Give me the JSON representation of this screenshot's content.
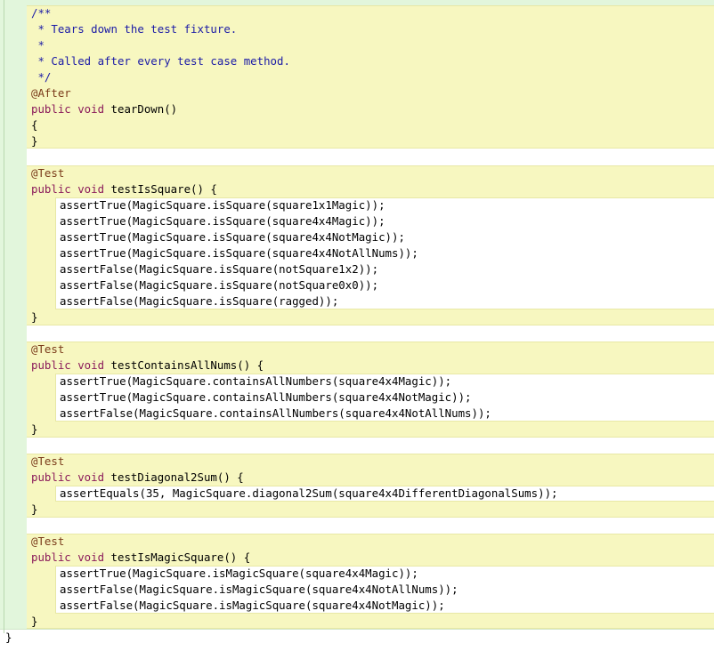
{
  "editor": {
    "lines": [
      {
        "indent": 1,
        "tokens": [
          {
            "t": "/**",
            "k": "comment"
          }
        ]
      },
      {
        "indent": 1,
        "tokens": [
          {
            "t": " * Tears down the test fixture.",
            "k": "comment"
          }
        ]
      },
      {
        "indent": 1,
        "tokens": [
          {
            "t": " *",
            "k": "comment"
          }
        ]
      },
      {
        "indent": 1,
        "tokens": [
          {
            "t": " * Called after every test case method.",
            "k": "comment"
          }
        ]
      },
      {
        "indent": 1,
        "tokens": [
          {
            "t": " */",
            "k": "comment"
          }
        ]
      },
      {
        "indent": 1,
        "tokens": [
          {
            "t": "@After",
            "k": "anno"
          }
        ]
      },
      {
        "indent": 1,
        "tokens": [
          {
            "t": "public void",
            "k": "kw"
          },
          {
            "t": " tearDown()",
            "k": "plain"
          }
        ]
      },
      {
        "indent": 1,
        "tokens": [
          {
            "t": "{",
            "k": "plain"
          }
        ]
      },
      {
        "indent": 1,
        "tokens": [
          {
            "t": "}",
            "k": "plain"
          }
        ]
      },
      {
        "indent": 1,
        "tokens": []
      },
      {
        "indent": 1,
        "tokens": [
          {
            "t": "@Test",
            "k": "anno"
          }
        ]
      },
      {
        "indent": 1,
        "tokens": [
          {
            "t": "public void",
            "k": "kw"
          },
          {
            "t": " testIsSquare() {",
            "k": "plain"
          }
        ]
      },
      {
        "indent": 2,
        "tokens": [
          {
            "t": "assertTrue(MagicSquare.isSquare(square1x1Magic));",
            "k": "plain"
          }
        ]
      },
      {
        "indent": 2,
        "tokens": [
          {
            "t": "assertTrue(MagicSquare.isSquare(square4x4Magic));",
            "k": "plain"
          }
        ]
      },
      {
        "indent": 2,
        "tokens": [
          {
            "t": "assertTrue(MagicSquare.isSquare(square4x4NotMagic));",
            "k": "plain"
          }
        ]
      },
      {
        "indent": 2,
        "tokens": [
          {
            "t": "assertTrue(MagicSquare.isSquare(square4x4NotAllNums));",
            "k": "plain"
          }
        ]
      },
      {
        "indent": 2,
        "tokens": [
          {
            "t": "assertFalse(MagicSquare.isSquare(notSquare1x2));",
            "k": "plain"
          }
        ]
      },
      {
        "indent": 2,
        "tokens": [
          {
            "t": "assertFalse(MagicSquare.isSquare(notSquare0x0));",
            "k": "plain"
          }
        ]
      },
      {
        "indent": 2,
        "tokens": [
          {
            "t": "assertFalse(MagicSquare.isSquare(ragged));",
            "k": "plain"
          }
        ]
      },
      {
        "indent": 1,
        "tokens": [
          {
            "t": "}",
            "k": "plain"
          }
        ]
      },
      {
        "indent": 1,
        "tokens": []
      },
      {
        "indent": 1,
        "tokens": [
          {
            "t": "@Test",
            "k": "anno"
          }
        ]
      },
      {
        "indent": 1,
        "tokens": [
          {
            "t": "public void",
            "k": "kw"
          },
          {
            "t": " testContainsAllNums() {",
            "k": "plain"
          }
        ]
      },
      {
        "indent": 2,
        "tokens": [
          {
            "t": "assertTrue(MagicSquare.containsAllNumbers(square4x4Magic));",
            "k": "plain"
          }
        ]
      },
      {
        "indent": 2,
        "tokens": [
          {
            "t": "assertTrue(MagicSquare.containsAllNumbers(square4x4NotMagic));",
            "k": "plain"
          }
        ]
      },
      {
        "indent": 2,
        "tokens": [
          {
            "t": "assertFalse(MagicSquare.containsAllNumbers(square4x4NotAllNums));",
            "k": "plain"
          }
        ]
      },
      {
        "indent": 1,
        "tokens": [
          {
            "t": "}",
            "k": "plain"
          }
        ]
      },
      {
        "indent": 1,
        "tokens": []
      },
      {
        "indent": 1,
        "tokens": [
          {
            "t": "@Test",
            "k": "anno"
          }
        ]
      },
      {
        "indent": 1,
        "tokens": [
          {
            "t": "public void",
            "k": "kw"
          },
          {
            "t": " testDiagonal2Sum() {",
            "k": "plain"
          }
        ]
      },
      {
        "indent": 2,
        "tokens": [
          {
            "t": "assertEquals(35, MagicSquare.diagonal2Sum(square4x4DifferentDiagonalSums));",
            "k": "plain"
          }
        ]
      },
      {
        "indent": 1,
        "tokens": [
          {
            "t": "}",
            "k": "plain"
          }
        ]
      },
      {
        "indent": 1,
        "tokens": []
      },
      {
        "indent": 1,
        "tokens": [
          {
            "t": "@Test",
            "k": "anno"
          }
        ]
      },
      {
        "indent": 1,
        "tokens": [
          {
            "t": "public void",
            "k": "kw"
          },
          {
            "t": " testIsMagicSquare() {",
            "k": "plain"
          }
        ]
      },
      {
        "indent": 2,
        "tokens": [
          {
            "t": "assertTrue(MagicSquare.isMagicSquare(square4x4Magic));",
            "k": "plain"
          }
        ]
      },
      {
        "indent": 2,
        "tokens": [
          {
            "t": "assertFalse(MagicSquare.isMagicSquare(square4x4NotAllNums));",
            "k": "plain"
          }
        ]
      },
      {
        "indent": 2,
        "tokens": [
          {
            "t": "assertFalse(MagicSquare.isMagicSquare(square4x4NotMagic));",
            "k": "plain"
          }
        ]
      },
      {
        "indent": 1,
        "tokens": [
          {
            "t": "}",
            "k": "plain"
          }
        ]
      },
      {
        "indent": 0,
        "tokens": [
          {
            "t": "}",
            "k": "plain"
          }
        ]
      }
    ]
  },
  "colors": {
    "comment": "#1a1aa6",
    "annotation": "#7a3b1a",
    "keyword": "#8b1b5a",
    "method_scope": "#f7f7c0",
    "class_scope": "#e2f6dc"
  }
}
